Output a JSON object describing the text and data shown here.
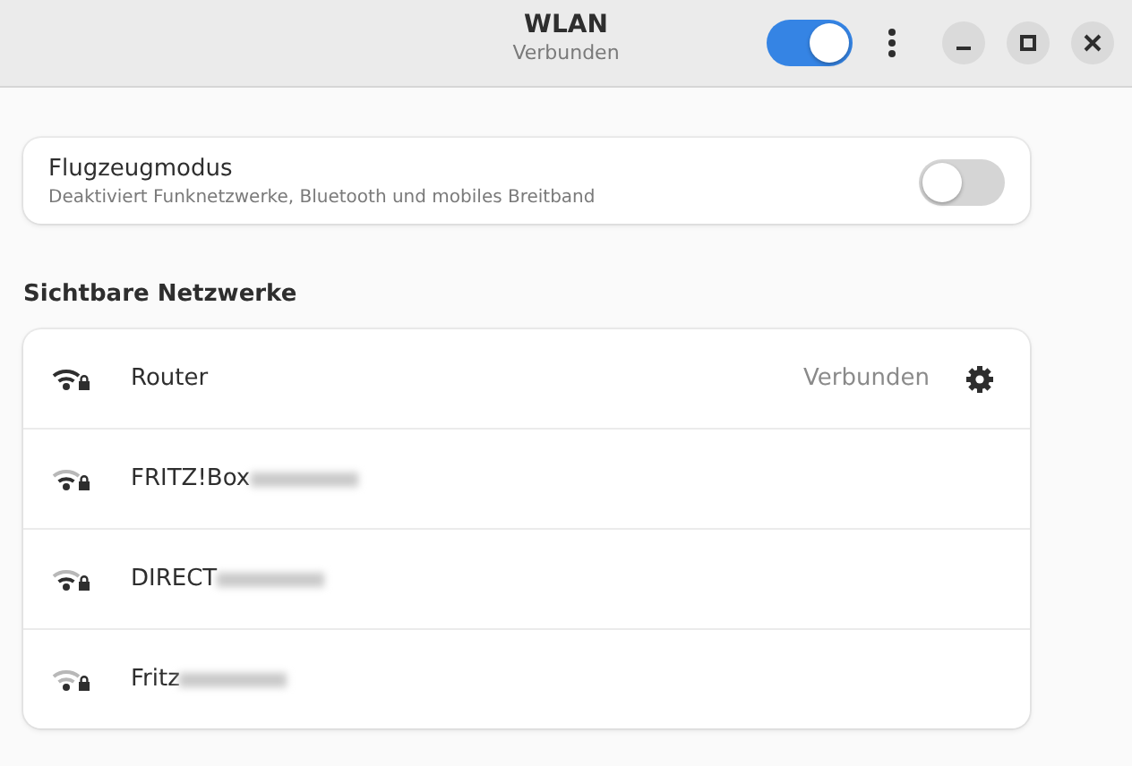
{
  "window": {
    "title": "WLAN",
    "subtitle": "Verbunden",
    "wifi_on": true
  },
  "airplane": {
    "title": "Flugzeugmodus",
    "description": "Deaktiviert Funknetzwerke, Bluetooth und mobiles Breitband",
    "on": false
  },
  "networks_heading": "Sichtbare Netzwerke",
  "networks": [
    {
      "name": "Router",
      "kind": "strong",
      "status": "Verbunden",
      "connected": true,
      "redacted": false
    },
    {
      "name": "FRITZ!Box",
      "kind": "medium",
      "connected": false,
      "redacted": true
    },
    {
      "name": "DIRECT",
      "kind": "medium",
      "connected": false,
      "redacted": true
    },
    {
      "name": "Fritz",
      "kind": "weak",
      "connected": false,
      "redacted": true
    }
  ]
}
